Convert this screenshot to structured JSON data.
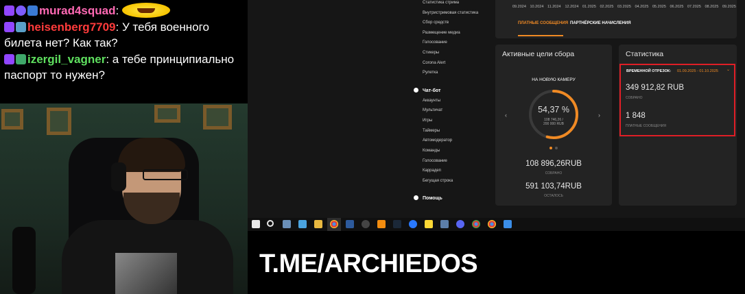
{
  "chat": {
    "messages": [
      {
        "user": "murad4squad",
        "user_color": "#ff69b4",
        "text": ":",
        "badges": [
          "twitch",
          "check",
          "gift"
        ]
      },
      {
        "user": "heisenberg7709",
        "user_color": "#ff3b3b",
        "text": ": У тебя военного билета нет? Как так?",
        "badges": [
          "twitch",
          "tool"
        ]
      },
      {
        "user": "izergil_vagner",
        "user_color": "#5fe05f",
        "text": ": а тебе принципиально паспорт то нужен?",
        "badges": [
          "twitch",
          "money"
        ]
      }
    ]
  },
  "nav": {
    "items_top": [
      "Статистика стрима",
      "Внутристримовая статистика",
      "Сбор средств",
      "Размещение медиа",
      "Голосование",
      "Стикеры",
      "Corona Alert",
      "Рулетка"
    ],
    "chatbot_label": "Чат-бот",
    "chatbot_items": [
      "Аккаунты",
      "Мультичат",
      "Игры",
      "Таймеры",
      "Автомодератор",
      "Команды",
      "Голосование",
      "Каррадеп",
      "Бегущая строка"
    ],
    "help_label": "Помощь"
  },
  "top_panel": {
    "months": [
      "09.2024",
      "10.2024",
      "11.2024",
      "12.2024",
      "01.2025",
      "02.2025",
      "03.2025",
      "04.2025",
      "05.2025",
      "06.2025",
      "07.2025",
      "08.2025",
      "09.2025"
    ],
    "tab_active": "ПЛАТНЫЕ СООБЩЕНИЯ",
    "tab_inactive": "ПАРТНЁРСКИЕ НАЧИСЛЕНИЯ"
  },
  "goals": {
    "title": "Активные цели сбора",
    "goal_name": "НА НОВУЮ КАМЕРУ",
    "percent_text": "54,37 %",
    "percent_value": 0.5437,
    "ring_sub_line1": "108 746,26 /",
    "ring_sub_line2": "200 000 RUB",
    "arrow_left": "‹",
    "arrow_right": "›",
    "collected_value": "108 896,26RUB",
    "collected_label": "СОБРАНО",
    "remaining_value": "591 103,74RUB",
    "remaining_label": "ОСТАЛОСЬ"
  },
  "stats": {
    "title": "Статистика",
    "period_label": "ВРЕМЕННОЙ ОТРЕЗОК:",
    "period_value": "01.09.2025 - 01.10.2025",
    "period_chevron": "⌄",
    "amount_value": "349 912,82 RUB",
    "amount_label": "СОБРАНО",
    "messages_value": "1 848",
    "messages_label": "ПЛАТНЫЕ СООБЩЕНИЯ"
  },
  "colors": {
    "accent_orange": "#f08a24",
    "highlight_red": "#e01e26",
    "panel_bg": "#232323"
  },
  "taskbar": {
    "icons": [
      "windows-icon",
      "search-icon",
      "task-view-icon",
      "explorer-icon",
      "folder-icon",
      "chrome-icon",
      "powershell-icon",
      "obs-icon",
      "vlc-icon",
      "steam-icon",
      "media-icon",
      "notes-icon",
      "steam2-icon",
      "discord-icon",
      "chrome2-icon",
      "chrome3-icon",
      "app-icon"
    ]
  },
  "banner": {
    "text": "T.ME/ARCHIEDOS"
  }
}
